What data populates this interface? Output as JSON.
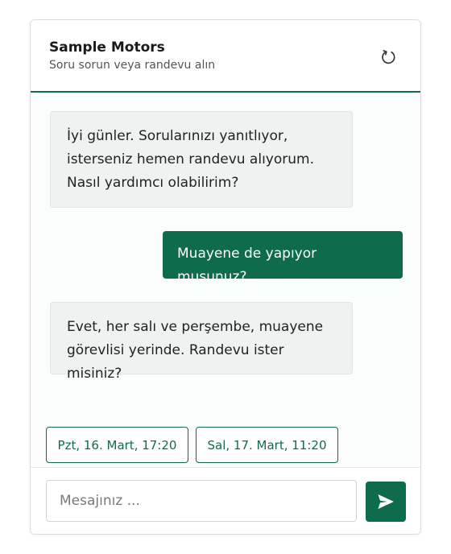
{
  "header": {
    "title": "Sample Motors",
    "subtitle": "Soru sorun veya randevu alın",
    "refresh_icon": "refresh-icon"
  },
  "messages": [
    {
      "sender": "bot",
      "text": "İyi günler. Sorularınızı yanıtlıyor, isterseniz hemen randevu alıyorum. Nasıl yardımcı olabilirim?"
    },
    {
      "sender": "user",
      "text": "Muayene de yapıyor musunuz?"
    },
    {
      "sender": "bot",
      "text": "Evet, her salı ve perşembe, muayene görevlisi yerinde. Randevu ister misiniz?"
    }
  ],
  "slots": [
    {
      "label": "Pzt, 16. Mart, 17:20"
    },
    {
      "label": "Sal, 17. Mart, 11:20"
    }
  ],
  "composer": {
    "value": "",
    "placeholder": "Mesajınız ...",
    "send_icon": "send-icon"
  },
  "colors": {
    "accent": "#0e6b4b",
    "bot_bubble": "#eef2f0"
  }
}
